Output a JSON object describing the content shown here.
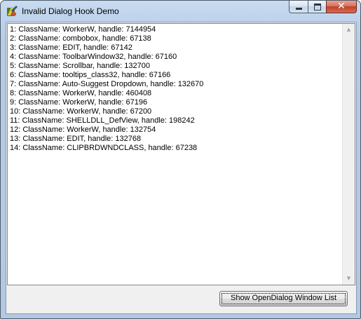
{
  "window": {
    "title": "Invalid Dialog Hook Demo",
    "icon": "app-icon",
    "controls": {
      "minimize": "minimize-icon",
      "maximize": "maximize-icon",
      "close": "✕"
    }
  },
  "list": {
    "items": [
      "1: ClassName: WorkerW, handle: 7144954",
      "2: ClassName: combobox, handle: 67138",
      "3: ClassName: EDIT, handle: 67142",
      "4: ClassName: ToolbarWindow32, handle: 67160",
      "5: ClassName: Scrollbar, handle: 132700",
      "6: ClassName: tooltips_class32, handle: 67166",
      "7: ClassName: Auto-Suggest Dropdown, handle: 132670",
      "8: ClassName: WorkerW, handle: 460408",
      "9: ClassName: WorkerW, handle: 67196",
      "10: ClassName: WorkerW, handle: 67200",
      "11: ClassName: SHELLDLL_DefView, handle: 198242",
      "12: ClassName: WorkerW, handle: 132754",
      "13: ClassName: EDIT, handle: 132768",
      "14: ClassName: CLIPBRDWNDCLASS, handle: 67238"
    ],
    "scroll_up": "▲",
    "scroll_down": "▼"
  },
  "button": {
    "label": "Show OpenDialog Window List"
  },
  "colors": {
    "titlebar": "#c9dbef",
    "close_button": "#c2402a",
    "client_bg": "#f0f0f0",
    "list_bg": "#ffffff"
  }
}
